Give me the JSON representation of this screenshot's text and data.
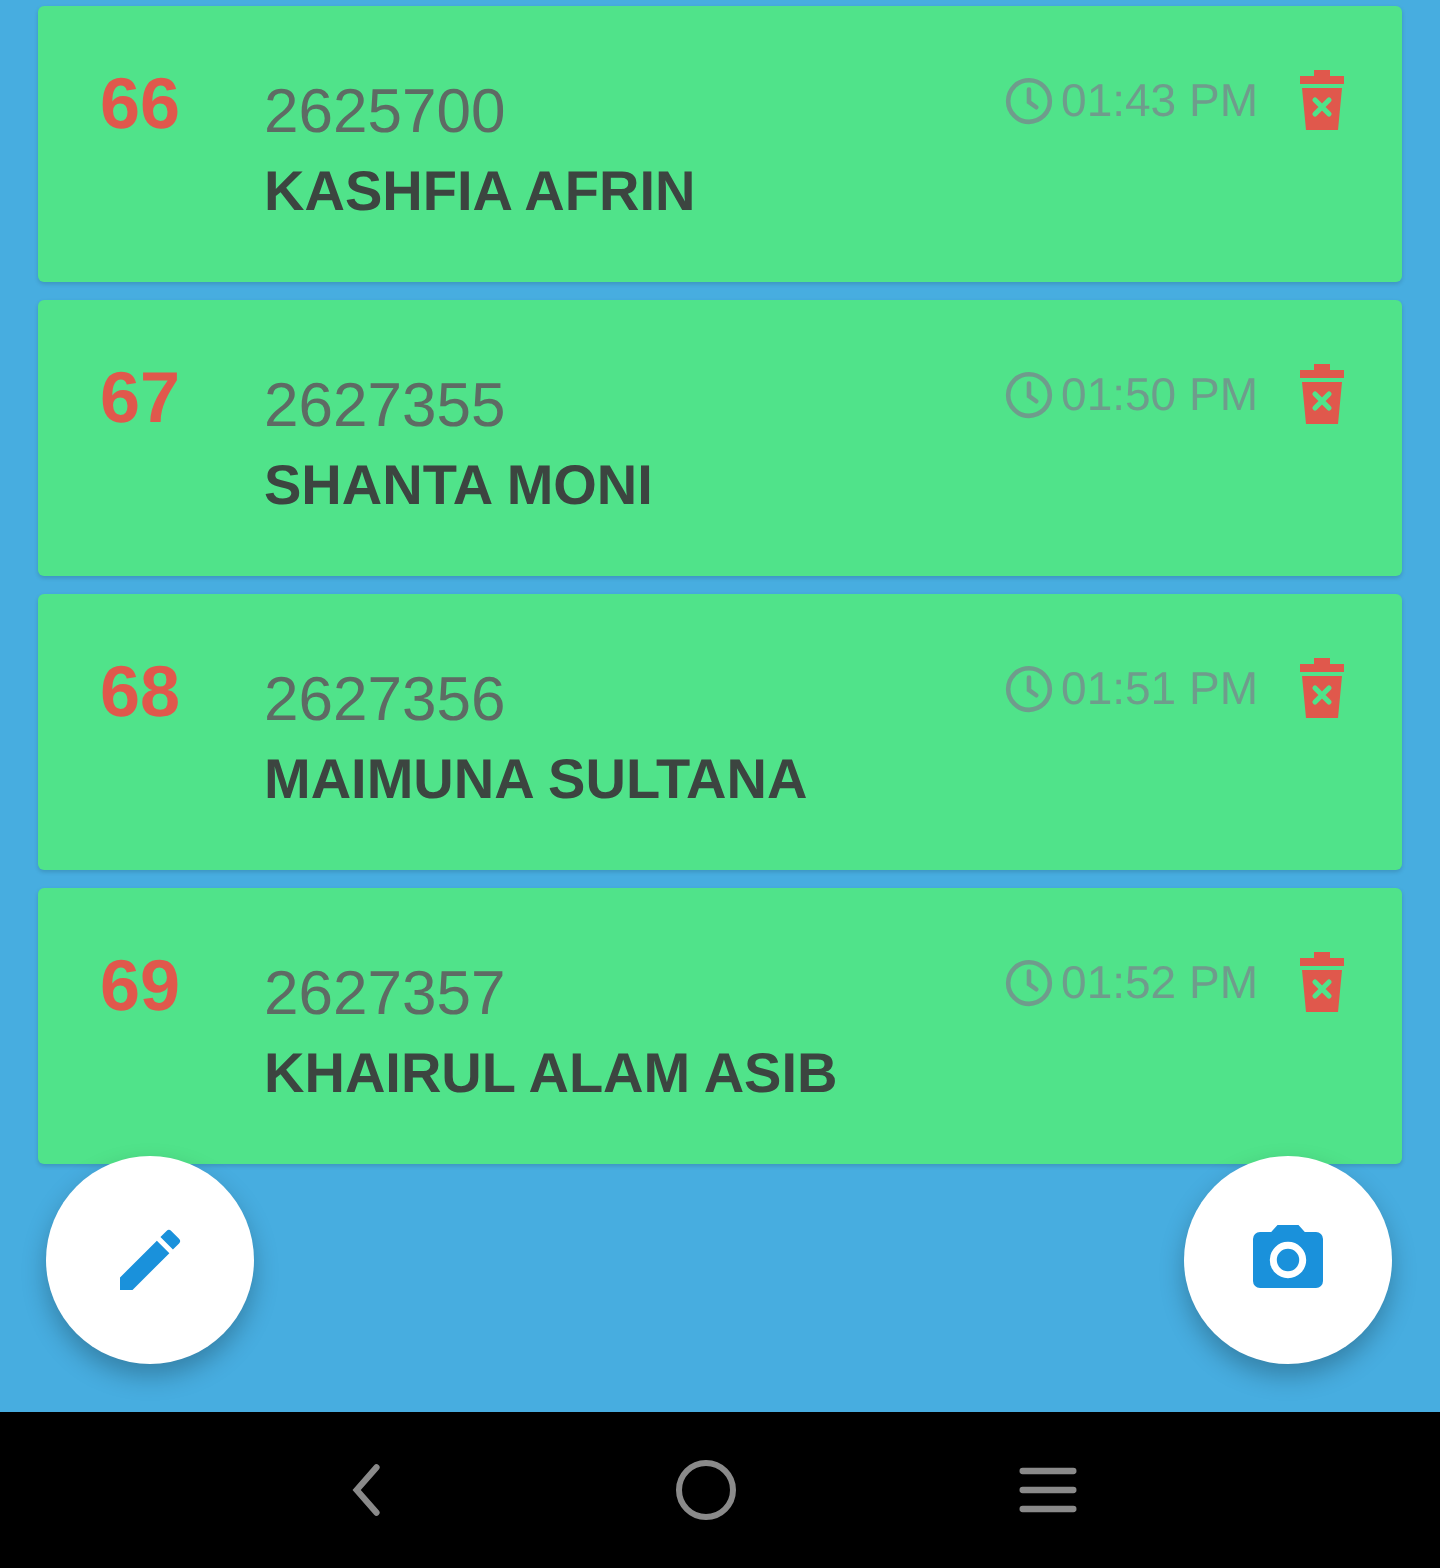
{
  "entries": [
    {
      "serial": "66",
      "code": "2625700",
      "name": "KASHFIA AFRIN",
      "time": "01:43 PM"
    },
    {
      "serial": "67",
      "code": "2627355",
      "name": "SHANTA MONI",
      "time": "01:50 PM"
    },
    {
      "serial": "68",
      "code": "2627356",
      "name": "MAIMUNA SULTANA",
      "time": "01:51 PM"
    },
    {
      "serial": "69",
      "code": "2627357",
      "name": "KHAIRUL ALAM ASIB",
      "time": "01:52 PM"
    }
  ]
}
